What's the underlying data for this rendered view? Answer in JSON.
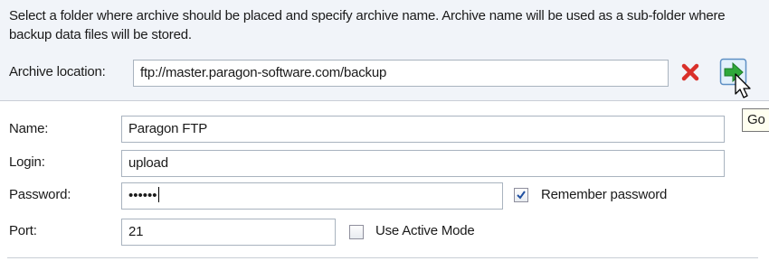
{
  "description": "Select a folder where archive should be placed and specify archive name. Archive name will be used as a sub-folder where backup data files will be stored.",
  "archive_location": {
    "label": "Archive location:",
    "value": "ftp://master.paragon-software.com/backup",
    "clear_icon": "red-x-icon",
    "go_icon": "green-arrow-icon",
    "tooltip": "Go"
  },
  "form": {
    "name_label": "Name:",
    "name_value": "Paragon FTP",
    "login_label": "Login:",
    "login_value": "upload",
    "password_label": "Password:",
    "password_value": "••••••",
    "remember_label": "Remember password",
    "remember_checked": true,
    "port_label": "Port:",
    "port_value": "21",
    "active_mode_label": "Use Active Mode",
    "active_mode_checked": false
  },
  "colors": {
    "panel_bg": "#f1f4f9",
    "clear_red": "#d9302a",
    "go_green": "#2fa83a",
    "check_blue": "#1f4fa0"
  }
}
